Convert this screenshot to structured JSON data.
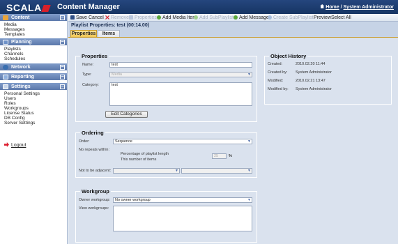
{
  "header": {
    "brand": "SCALA",
    "app_title": "Content Manager",
    "home_link": "Home",
    "separator": "/",
    "user_link": "System Administrator"
  },
  "sidebar": {
    "sections": [
      {
        "title": "Content",
        "icon": "content-icon",
        "icon_color": "#e9a43a",
        "items": [
          "Media",
          "Messages",
          "Templates"
        ]
      },
      {
        "title": "Planning",
        "icon": "planning-icon",
        "icon_color": "#6f92c8",
        "items": [
          "Playlists",
          "Channels",
          "Schedules"
        ]
      },
      {
        "title": "Network",
        "icon": "network-icon",
        "icon_color": "#3a6fb0",
        "items": []
      },
      {
        "title": "Reporting",
        "icon": "reporting-icon",
        "icon_color": "#8fb0de",
        "items": []
      },
      {
        "title": "Settings",
        "icon": "settings-icon",
        "icon_color": "#c8d6ea",
        "items": [
          "Personal Settings",
          "Users",
          "Roles",
          "Workgroups",
          "License Status",
          "DB Config",
          "Server Settings"
        ]
      }
    ],
    "collapse_symbol": "−",
    "logout": "Logout"
  },
  "toolbar": {
    "save": "Save",
    "cancel": "Cancel",
    "remove": "Remove",
    "properties": "Properties",
    "add_media": "Add Media Item",
    "add_subplaylist": "Add SubPlaylist",
    "add_message": "Add Message",
    "create_subplaylist": "Create SubPlaylist",
    "preview": "Preview",
    "select_all": "Select All"
  },
  "page": {
    "title": "Playlist Properties: test (00:14.00)",
    "tabs": [
      "Properties",
      "Items"
    ]
  },
  "general": {
    "legend": "Properties",
    "name_label": "Name:",
    "name_value": "test",
    "type_label": "Type:",
    "type_value": "Media",
    "category_label": "Category:",
    "category_value": "test",
    "edit_categories": "Edit Categories"
  },
  "history": {
    "legend": "Object History",
    "rows": [
      {
        "label": "Created:",
        "value": "2010.02.20 11:44"
      },
      {
        "label": "Created by:",
        "value": "System Administrator"
      },
      {
        "label": "Modified:",
        "value": "2010.02.21 13:47"
      },
      {
        "label": "Modified by:",
        "value": "System Administrator"
      }
    ]
  },
  "ordering": {
    "legend": "Ordering",
    "order_label": "Order:",
    "order_value": "Sequence",
    "no_repeats_label": "No repeats within:",
    "pct_label": "Percentage of playlist length",
    "pct_value": "25",
    "pct_unit": "%",
    "items_label": "This number of items",
    "not_adjacent_label": "Not to be adjacent:"
  },
  "workgroup": {
    "legend": "Workgroup",
    "owner_label": "Owner workgroup:",
    "owner_value": "No owner workgroup",
    "view_label": "View workgroups:"
  }
}
